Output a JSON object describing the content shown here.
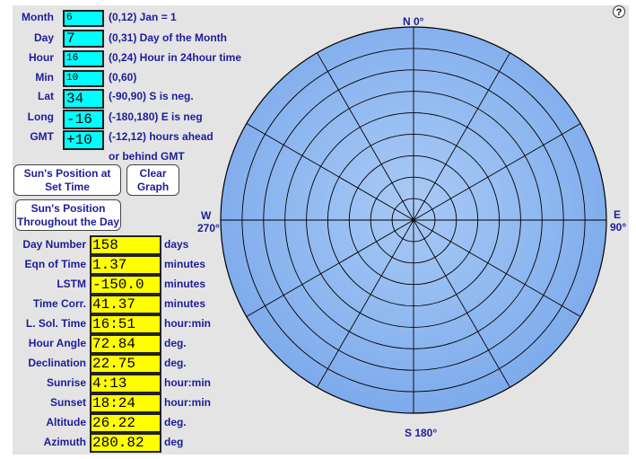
{
  "inputs": [
    {
      "key": "month",
      "label": "Month",
      "value": "6",
      "hint": "(0,12) Jan = 1"
    },
    {
      "key": "day",
      "label": "Day",
      "value": "7",
      "hint": "(0,31) Day of the Month"
    },
    {
      "key": "hour",
      "label": "Hour",
      "value": "16",
      "hint": "(0,24) Hour in 24hour time"
    },
    {
      "key": "min",
      "label": "Min",
      "value": "10",
      "hint": "(0,60)"
    },
    {
      "key": "lat",
      "label": "Lat",
      "value": "34",
      "hint": "(-90,90) S is neg."
    },
    {
      "key": "long",
      "label": "Long",
      "value": "-16",
      "hint": "(-180,180) E is neg"
    },
    {
      "key": "gmt",
      "label": "GMT",
      "value": "+10",
      "hint": "(-12,12) hours ahead",
      "hint2": "or behind GMT"
    }
  ],
  "buttons": {
    "set_time": "Sun's Position at Set Time",
    "clear": "Clear Graph",
    "throughout": "Sun's Position Throughout the Day"
  },
  "outputs": [
    {
      "key": "day_number",
      "label": "Day Number",
      "value": "158",
      "unit": "days"
    },
    {
      "key": "eqn_of_time",
      "label": "Eqn of Time",
      "value": "1.37",
      "unit": "minutes"
    },
    {
      "key": "lstm",
      "label": "LSTM",
      "value": "-150.0",
      "unit": "minutes"
    },
    {
      "key": "time_corr",
      "label": "Time Corr.",
      "value": "41.37",
      "unit": "minutes"
    },
    {
      "key": "l_sol_time",
      "label": "L. Sol. Time",
      "value": "16:51",
      "unit": "hour:min"
    },
    {
      "key": "hour_angle",
      "label": "Hour Angle",
      "value": "72.84",
      "unit": "deg."
    },
    {
      "key": "declination",
      "label": "Declination",
      "value": "22.75",
      "unit": "deg."
    },
    {
      "key": "sunrise",
      "label": "Sunrise",
      "value": "4:13",
      "unit": "hour:min"
    },
    {
      "key": "sunset",
      "label": "Sunset",
      "value": "18:24",
      "unit": "hour:min"
    },
    {
      "key": "altitude",
      "label": "Altitude",
      "value": "26.22",
      "unit": "deg."
    },
    {
      "key": "azimuth",
      "label": "Azimuth",
      "value": "280.82",
      "unit": "deg"
    }
  ],
  "compass": {
    "north": "N 0°",
    "east_letter": "E",
    "east_deg": "90°",
    "south": "S 180°",
    "west_letter": "W",
    "west_deg": "270°"
  },
  "help_label": "?",
  "colors": {
    "panel": "#e4e4e4",
    "label_text": "#1d1d99",
    "input_bg": "#00ffff",
    "output_bg": "#ffff00",
    "sky": "#8fb8f0"
  }
}
